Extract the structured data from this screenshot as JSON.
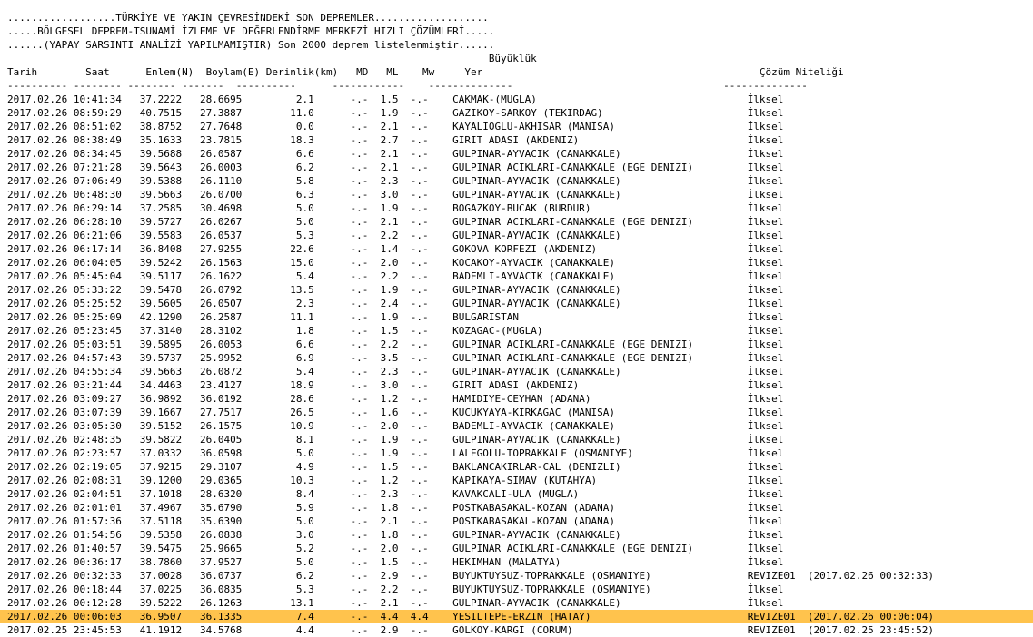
{
  "colors": {
    "background": "#ffffff",
    "text": "#000000",
    "highlight_row": "#ffc34d"
  },
  "header_lines": [
    "..................TÜRKİYE VE YAKIN ÇEVRESİNDEKİ SON DEPREMLER...................",
    ".....BÖLGESEL DEPREM-TSUNAMİ İZLEME VE DEĞERLENDİRME MERKEZİ HIZLI ÇÖZÜMLERİ.....",
    "......(YAPAY SARSINTI ANALİZİ YAPILMAMIŞTIR) Son 2000 deprem listelenmiştir......"
  ],
  "columns": {
    "magnitude_group": "Büyüklük",
    "date": "Tarih",
    "time": "Saat",
    "lat": "Enlem(N)",
    "lon": "Boylam(E)",
    "depth": "Derinlik(km)",
    "md": "MD",
    "ml": "ML",
    "mw": "Mw",
    "location": "Yer",
    "solution": "Çözüm Niteliği"
  },
  "dividers": {
    "magnitude": "------------",
    "date": "----------",
    "time": "--------",
    "lat": "--------",
    "lon": "-------",
    "depth": "----------",
    "location": "--------------",
    "solution": "--------------"
  },
  "highlight_index": 38,
  "rows": [
    [
      "2017.02.26",
      "10:41:34",
      "37.2222",
      "28.6695",
      "2.1",
      "-.-",
      "1.5",
      "-.-",
      "CAKMAK-(MUGLA)",
      "İlksel",
      ""
    ],
    [
      "2017.02.26",
      "08:59:29",
      "40.7515",
      "27.3887",
      "11.0",
      "-.-",
      "1.9",
      "-.-",
      "GAZIKOY-SARKOY (TEKIRDAG)",
      "İlksel",
      ""
    ],
    [
      "2017.02.26",
      "08:51:02",
      "38.8752",
      "27.7648",
      "0.0",
      "-.-",
      "2.1",
      "-.-",
      "KAYALIOGLU-AKHISAR (MANISA)",
      "İlksel",
      ""
    ],
    [
      "2017.02.26",
      "08:38:49",
      "35.1633",
      "23.7815",
      "18.3",
      "-.-",
      "2.7",
      "-.-",
      "GIRIT ADASI (AKDENIZ)",
      "İlksel",
      ""
    ],
    [
      "2017.02.26",
      "08:34:45",
      "39.5688",
      "26.0587",
      "6.6",
      "-.-",
      "2.1",
      "-.-",
      "GULPINAR-AYVACIK (CANAKKALE)",
      "İlksel",
      ""
    ],
    [
      "2017.02.26",
      "07:21:28",
      "39.5643",
      "26.0003",
      "6.2",
      "-.-",
      "2.1",
      "-.-",
      "GULPINAR ACIKLARI-CANAKKALE (EGE DENIZI)",
      "İlksel",
      ""
    ],
    [
      "2017.02.26",
      "07:06:49",
      "39.5388",
      "26.1110",
      "5.8",
      "-.-",
      "2.3",
      "-.-",
      "GULPINAR-AYVACIK (CANAKKALE)",
      "İlksel",
      ""
    ],
    [
      "2017.02.26",
      "06:48:30",
      "39.5663",
      "26.0700",
      "6.3",
      "-.-",
      "3.0",
      "-.-",
      "GULPINAR-AYVACIK (CANAKKALE)",
      "İlksel",
      ""
    ],
    [
      "2017.02.26",
      "06:29:14",
      "37.2585",
      "30.4698",
      "5.0",
      "-.-",
      "1.9",
      "-.-",
      "BOGAZKOY-BUCAK (BURDUR)",
      "İlksel",
      ""
    ],
    [
      "2017.02.26",
      "06:28:10",
      "39.5727",
      "26.0267",
      "5.0",
      "-.-",
      "2.1",
      "-.-",
      "GULPINAR ACIKLARI-CANAKKALE (EGE DENIZI)",
      "İlksel",
      ""
    ],
    [
      "2017.02.26",
      "06:21:06",
      "39.5583",
      "26.0537",
      "5.3",
      "-.-",
      "2.2",
      "-.-",
      "GULPINAR-AYVACIK (CANAKKALE)",
      "İlksel",
      ""
    ],
    [
      "2017.02.26",
      "06:17:14",
      "36.8408",
      "27.9255",
      "22.6",
      "-.-",
      "1.4",
      "-.-",
      "GOKOVA KORFEZI (AKDENIZ)",
      "İlksel",
      ""
    ],
    [
      "2017.02.26",
      "06:04:05",
      "39.5242",
      "26.1563",
      "15.0",
      "-.-",
      "2.0",
      "-.-",
      "KOCAKOY-AYVACIK (CANAKKALE)",
      "İlksel",
      ""
    ],
    [
      "2017.02.26",
      "05:45:04",
      "39.5117",
      "26.1622",
      "5.4",
      "-.-",
      "2.2",
      "-.-",
      "BADEMLI-AYVACIK (CANAKKALE)",
      "İlksel",
      ""
    ],
    [
      "2017.02.26",
      "05:33:22",
      "39.5478",
      "26.0792",
      "13.5",
      "-.-",
      "1.9",
      "-.-",
      "GULPINAR-AYVACIK (CANAKKALE)",
      "İlksel",
      ""
    ],
    [
      "2017.02.26",
      "05:25:52",
      "39.5605",
      "26.0507",
      "2.3",
      "-.-",
      "2.4",
      "-.-",
      "GULPINAR-AYVACIK (CANAKKALE)",
      "İlksel",
      ""
    ],
    [
      "2017.02.26",
      "05:25:09",
      "42.1290",
      "26.2587",
      "11.1",
      "-.-",
      "1.9",
      "-.-",
      "BULGARISTAN",
      "İlksel",
      ""
    ],
    [
      "2017.02.26",
      "05:23:45",
      "37.3140",
      "28.3102",
      "1.8",
      "-.-",
      "1.5",
      "-.-",
      "KOZAGAC-(MUGLA)",
      "İlksel",
      ""
    ],
    [
      "2017.02.26",
      "05:03:51",
      "39.5895",
      "26.0053",
      "6.6",
      "-.-",
      "2.2",
      "-.-",
      "GULPINAR ACIKLARI-CANAKKALE (EGE DENIZI)",
      "İlksel",
      ""
    ],
    [
      "2017.02.26",
      "04:57:43",
      "39.5737",
      "25.9952",
      "6.9",
      "-.-",
      "3.5",
      "-.-",
      "GULPINAR ACIKLARI-CANAKKALE (EGE DENIZI)",
      "İlksel",
      ""
    ],
    [
      "2017.02.26",
      "04:55:34",
      "39.5663",
      "26.0872",
      "5.4",
      "-.-",
      "2.3",
      "-.-",
      "GULPINAR-AYVACIK (CANAKKALE)",
      "İlksel",
      ""
    ],
    [
      "2017.02.26",
      "03:21:44",
      "34.4463",
      "23.4127",
      "18.9",
      "-.-",
      "3.0",
      "-.-",
      "GIRIT ADASI (AKDENIZ)",
      "İlksel",
      ""
    ],
    [
      "2017.02.26",
      "03:09:27",
      "36.9892",
      "36.0192",
      "28.6",
      "-.-",
      "1.2",
      "-.-",
      "HAMIDIYE-CEYHAN (ADANA)",
      "İlksel",
      ""
    ],
    [
      "2017.02.26",
      "03:07:39",
      "39.1667",
      "27.7517",
      "26.5",
      "-.-",
      "1.6",
      "-.-",
      "KUCUKYAYA-KIRKAGAC (MANISA)",
      "İlksel",
      ""
    ],
    [
      "2017.02.26",
      "03:05:30",
      "39.5152",
      "26.1575",
      "10.9",
      "-.-",
      "2.0",
      "-.-",
      "BADEMLI-AYVACIK (CANAKKALE)",
      "İlksel",
      ""
    ],
    [
      "2017.02.26",
      "02:48:35",
      "39.5822",
      "26.0405",
      "8.1",
      "-.-",
      "1.9",
      "-.-",
      "GULPINAR-AYVACIK (CANAKKALE)",
      "İlksel",
      ""
    ],
    [
      "2017.02.26",
      "02:23:57",
      "37.0332",
      "36.0598",
      "5.0",
      "-.-",
      "1.9",
      "-.-",
      "LALEGOLU-TOPRAKKALE (OSMANIYE)",
      "İlksel",
      ""
    ],
    [
      "2017.02.26",
      "02:19:05",
      "37.9215",
      "29.3107",
      "4.9",
      "-.-",
      "1.5",
      "-.-",
      "BAKLANCAKIRLAR-CAL (DENIZLI)",
      "İlksel",
      ""
    ],
    [
      "2017.02.26",
      "02:08:31",
      "39.1200",
      "29.0365",
      "10.3",
      "-.-",
      "1.2",
      "-.-",
      "KAPIKAYA-SIMAV (KUTAHYA)",
      "İlksel",
      ""
    ],
    [
      "2017.02.26",
      "02:04:51",
      "37.1018",
      "28.6320",
      "8.4",
      "-.-",
      "2.3",
      "-.-",
      "KAVAKCALI-ULA (MUGLA)",
      "İlksel",
      ""
    ],
    [
      "2017.02.26",
      "02:01:01",
      "37.4967",
      "35.6790",
      "5.9",
      "-.-",
      "1.8",
      "-.-",
      "POSTKABASAKAL-KOZAN (ADANA)",
      "İlksel",
      ""
    ],
    [
      "2017.02.26",
      "01:57:36",
      "37.5118",
      "35.6390",
      "5.0",
      "-.-",
      "2.1",
      "-.-",
      "POSTKABASAKAL-KOZAN (ADANA)",
      "İlksel",
      ""
    ],
    [
      "2017.02.26",
      "01:54:56",
      "39.5358",
      "26.0838",
      "3.0",
      "-.-",
      "1.8",
      "-.-",
      "GULPINAR-AYVACIK (CANAKKALE)",
      "İlksel",
      ""
    ],
    [
      "2017.02.26",
      "01:40:57",
      "39.5475",
      "25.9665",
      "5.2",
      "-.-",
      "2.0",
      "-.-",
      "GULPINAR ACIKLARI-CANAKKALE (EGE DENIZI)",
      "İlksel",
      ""
    ],
    [
      "2017.02.26",
      "00:36:17",
      "38.7860",
      "37.9527",
      "5.0",
      "-.-",
      "1.5",
      "-.-",
      "HEKIMHAN (MALATYA)",
      "İlksel",
      ""
    ],
    [
      "2017.02.26",
      "00:32:33",
      "37.0028",
      "36.0737",
      "6.2",
      "-.-",
      "2.9",
      "-.-",
      "BUYUKTUYSUZ-TOPRAKKALE (OSMANIYE)",
      "REVIZE01",
      "(2017.02.26 00:32:33)"
    ],
    [
      "2017.02.26",
      "00:18:44",
      "37.0225",
      "36.0835",
      "5.3",
      "-.-",
      "2.2",
      "-.-",
      "BUYUKTUYSUZ-TOPRAKKALE (OSMANIYE)",
      "İlksel",
      ""
    ],
    [
      "2017.02.26",
      "00:12:28",
      "39.5222",
      "26.1263",
      "13.1",
      "-.-",
      "2.1",
      "-.-",
      "GULPINAR-AYVACIK (CANAKKALE)",
      "İlksel",
      ""
    ],
    [
      "2017.02.26",
      "00:06:03",
      "36.9507",
      "36.1335",
      "7.4",
      "-.-",
      "4.4",
      "4.4",
      "YESILTEPE-ERZIN (HATAY)",
      "REVIZE01",
      "(2017.02.26 00:06:04)"
    ],
    [
      "2017.02.25",
      "23:45:53",
      "41.1912",
      "34.5768",
      "4.4",
      "-.-",
      "2.9",
      "-.-",
      "GOLKOY-KARGI (CORUM)",
      "REVIZE01",
      "(2017.02.25 23:45:52)"
    ]
  ]
}
